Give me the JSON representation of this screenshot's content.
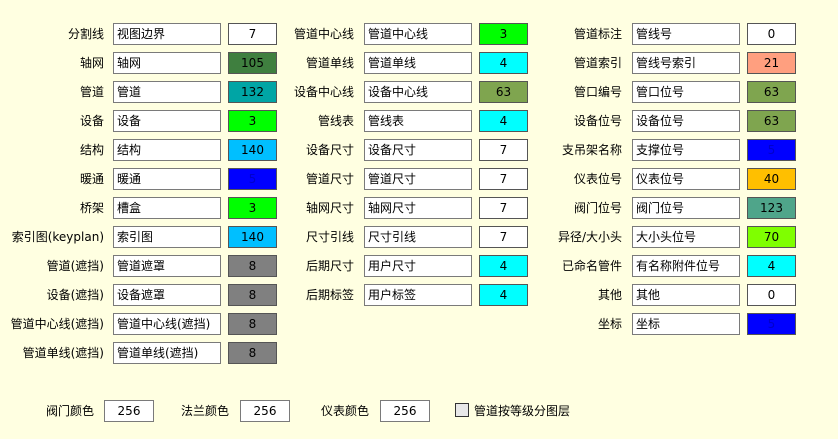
{
  "columns": [
    {
      "rows": [
        {
          "label": "分割线",
          "name": "视图边界",
          "value": "7",
          "color": "#ffffff",
          "text": "#000000"
        },
        {
          "label": "轴网",
          "name": "轴网",
          "value": "105",
          "color": "#3f7f3f",
          "text": "#000000"
        },
        {
          "label": "管道",
          "name": "管道",
          "value": "132",
          "color": "#00a5a5",
          "text": "#000000"
        },
        {
          "label": "设备",
          "name": "设备",
          "value": "3",
          "color": "#00ff00",
          "text": "#000000"
        },
        {
          "label": "结构",
          "name": "结构",
          "value": "140",
          "color": "#00bfff",
          "text": "#000000"
        },
        {
          "label": "暖通",
          "name": "暖通",
          "value": "5",
          "color": "#0000ff",
          "text": "#0000cc"
        },
        {
          "label": "桥架",
          "name": "槽盒",
          "value": "3",
          "color": "#00ff00",
          "text": "#000000"
        },
        {
          "label": "索引图(keyplan)",
          "name": "索引图",
          "value": "140",
          "color": "#00bfff",
          "text": "#000000"
        },
        {
          "label": "管道(遮挡)",
          "name": "管道遮罩",
          "value": "8",
          "color": "#808080",
          "text": "#000000"
        },
        {
          "label": "设备(遮挡)",
          "name": "设备遮罩",
          "value": "8",
          "color": "#808080",
          "text": "#000000"
        },
        {
          "label": "管道中心线(遮挡)",
          "name": "管道中心线(遮挡)",
          "value": "8",
          "color": "#808080",
          "text": "#000000"
        },
        {
          "label": "管道单线(遮挡)",
          "name": "管道单线(遮挡)",
          "value": "8",
          "color": "#808080",
          "text": "#000000"
        }
      ]
    },
    {
      "rows": [
        {
          "label": "管道中心线",
          "name": "管道中心线",
          "value": "3",
          "color": "#00ff00",
          "text": "#000000"
        },
        {
          "label": "管道单线",
          "name": "管道单线",
          "value": "4",
          "color": "#00ffff",
          "text": "#000000"
        },
        {
          "label": "设备中心线",
          "name": "设备中心线",
          "value": "63",
          "color": "#7fa54f",
          "text": "#000000"
        },
        {
          "label": "管线表",
          "name": "管线表",
          "value": "4",
          "color": "#00ffff",
          "text": "#000000"
        },
        {
          "label": "设备尺寸",
          "name": "设备尺寸",
          "value": "7",
          "color": "#ffffff",
          "text": "#000000"
        },
        {
          "label": "管道尺寸",
          "name": "管道尺寸",
          "value": "7",
          "color": "#ffffff",
          "text": "#000000"
        },
        {
          "label": "轴网尺寸",
          "name": "轴网尺寸",
          "value": "7",
          "color": "#ffffff",
          "text": "#000000"
        },
        {
          "label": "尺寸引线",
          "name": "尺寸引线",
          "value": "7",
          "color": "#ffffff",
          "text": "#000000"
        },
        {
          "label": "后期尺寸",
          "name": "用户尺寸",
          "value": "4",
          "color": "#00ffff",
          "text": "#000000"
        },
        {
          "label": "后期标签",
          "name": "用户标签",
          "value": "4",
          "color": "#00ffff",
          "text": "#000000"
        }
      ]
    },
    {
      "rows": [
        {
          "label": "管道标注",
          "name": "管线号",
          "value": "0",
          "color": "#ffffff",
          "text": "#000000"
        },
        {
          "label": "管道索引",
          "name": "管线号索引",
          "value": "21",
          "color": "#ff9f7f",
          "text": "#000000"
        },
        {
          "label": "管口编号",
          "name": "管口位号",
          "value": "63",
          "color": "#7fa54f",
          "text": "#000000"
        },
        {
          "label": "设备位号",
          "name": "设备位号",
          "value": "63",
          "color": "#7fa54f",
          "text": "#000000"
        },
        {
          "label": "支吊架名称",
          "name": "支撑位号",
          "value": "5",
          "color": "#0000ff",
          "text": "#0000cc"
        },
        {
          "label": "仪表位号",
          "name": "仪表位号",
          "value": "40",
          "color": "#ffbf00",
          "text": "#000000"
        },
        {
          "label": "阀门位号",
          "name": "阀门位号",
          "value": "123",
          "color": "#4fa58a",
          "text": "#000000"
        },
        {
          "label": "异径/大小头",
          "name": "大小头位号",
          "value": "70",
          "color": "#7fff00",
          "text": "#000000"
        },
        {
          "label": "已命名管件",
          "name": "有名称附件位号",
          "value": "4",
          "color": "#00ffff",
          "text": "#000000"
        },
        {
          "label": "其他",
          "name": "其他",
          "value": "0",
          "color": "#ffffff",
          "text": "#000000"
        },
        {
          "label": "坐标",
          "name": "坐标",
          "value": "5",
          "color": "#0000ff",
          "text": "#0000cc"
        }
      ]
    }
  ],
  "bottom": {
    "valve_color_label": "阀门颜色",
    "valve_color_value": "256",
    "flange_color_label": "法兰颜色",
    "flange_color_value": "256",
    "instrument_color_label": "仪表颜色",
    "instrument_color_value": "256",
    "layer_by_class_label": "管道按等级分图层",
    "layer_by_class_checked": false
  }
}
